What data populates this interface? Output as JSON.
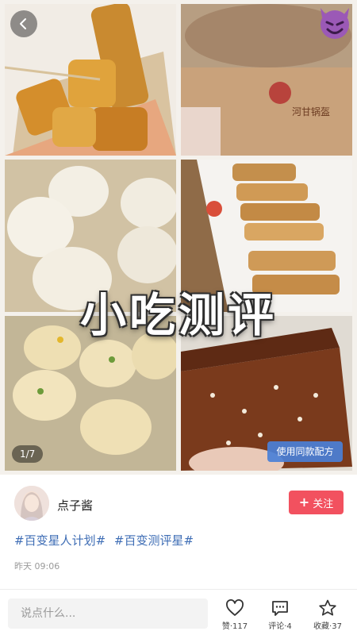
{
  "post": {
    "overlay_title": "小吃测评",
    "page_indicator": "1/7",
    "recipe_button": "使用同款配方"
  },
  "author": {
    "name": "点子酱",
    "follow_label": "关注"
  },
  "tags": [
    "#百变星人计划#",
    "#百变测评星#"
  ],
  "timestamp": "昨天 09:06",
  "bottom_bar": {
    "comment_placeholder": "说点什么...",
    "like_label": "赞·117",
    "comment_label": "评论·4",
    "favorite_label": "收藏·37"
  },
  "colors": {
    "follow_button": "#f2515f",
    "tag_link": "#3e6db5",
    "recipe_button": "#4a80d7"
  },
  "icons": [
    "back-arrow-icon",
    "devil-emoji-icon",
    "plus-icon",
    "heart-icon",
    "comment-icon",
    "star-icon"
  ]
}
